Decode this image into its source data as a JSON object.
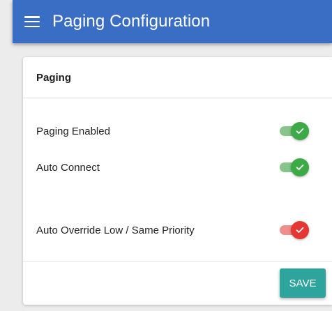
{
  "appbar": {
    "title": "Paging Configuration",
    "color": "#3a6ec4"
  },
  "card": {
    "header": "Paging",
    "settings": [
      {
        "label": "Paging Enabled",
        "enabled": true,
        "status_color": "#3caa46"
      },
      {
        "label": "Auto Connect",
        "enabled": true,
        "status_color": "#3caa46"
      },
      {
        "label": "Auto Override Low / Same Priority",
        "enabled": true,
        "status_color": "#e43632"
      }
    ],
    "save_label": "SAVE",
    "save_color": "#2ea59c"
  },
  "icons": {
    "menu": "hamburger-menu-icon",
    "toggle_check": "check-icon"
  }
}
